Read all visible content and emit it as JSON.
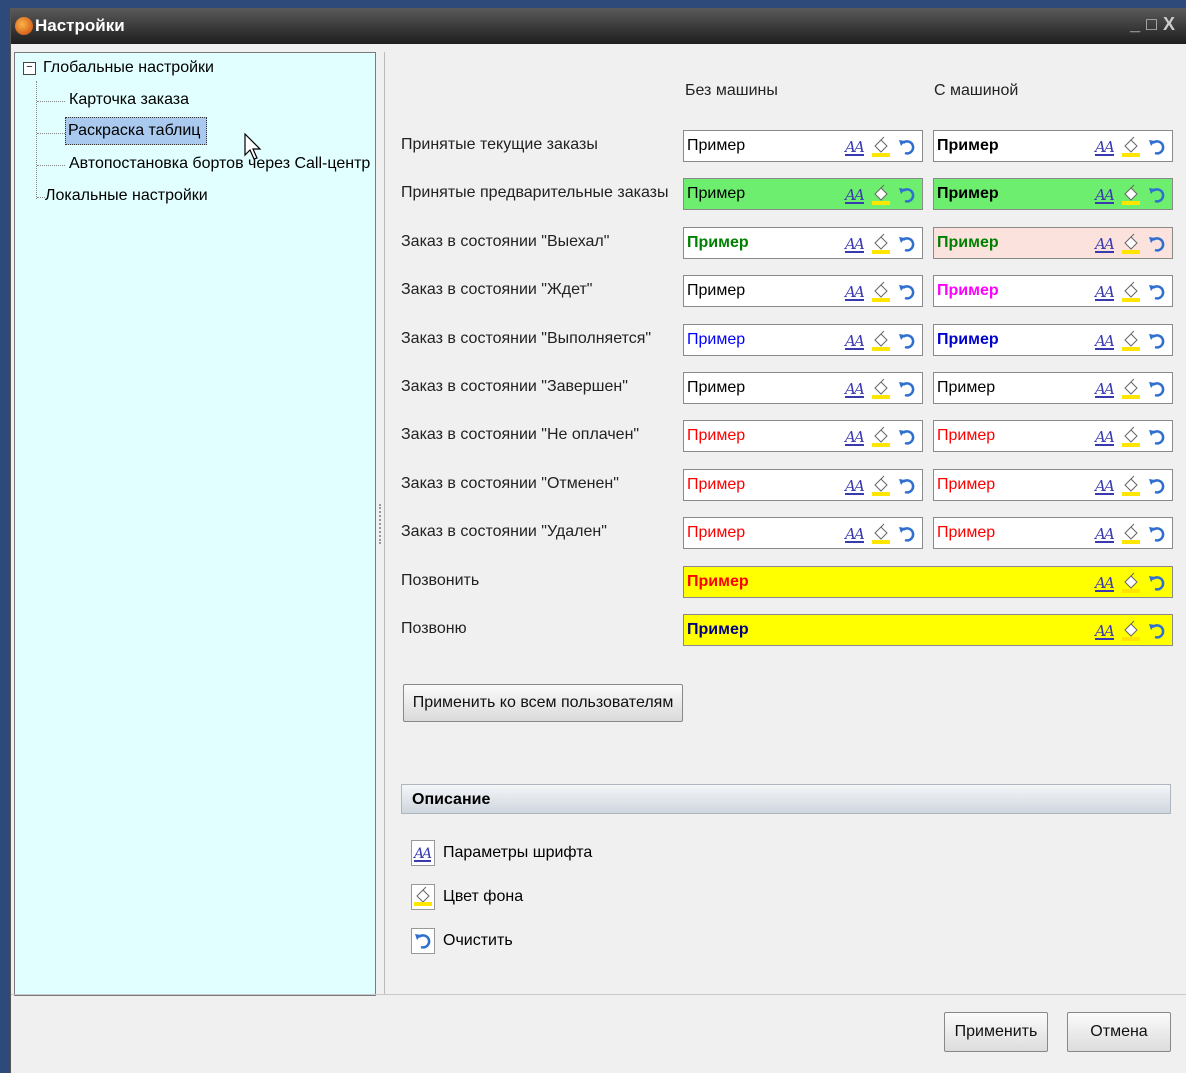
{
  "window": {
    "title": "Настройки",
    "controls": [
      "_",
      "□",
      "X"
    ]
  },
  "sidebar": {
    "nodes": [
      {
        "label": "Глобальные настройки",
        "expanded": true
      },
      {
        "label": "Карточка заказа"
      },
      {
        "label": "Раскраска таблиц",
        "selected": true
      },
      {
        "label": "Автопостановка бортов через Call-центр"
      },
      {
        "label": "Локальные настройки"
      }
    ]
  },
  "columns": {
    "without_car": "Без машины",
    "with_car": "С машиной"
  },
  "rows": [
    {
      "label": "Принятые текущие заказы",
      "a": {
        "text": "Пример",
        "color": "#000000",
        "bg": "#ffffff",
        "bold": false
      },
      "b": {
        "text": "Пример",
        "color": "#000000",
        "bg": "#ffffff",
        "bold": true
      }
    },
    {
      "label": "Принятые предварительные заказы",
      "a": {
        "text": "Пример",
        "color": "#000000",
        "bg": "#6eee6e",
        "bold": false
      },
      "b": {
        "text": "Пример",
        "color": "#000000",
        "bg": "#6eee6e",
        "bold": true
      }
    },
    {
      "label": "Заказ в состоянии \"Выехал\"",
      "a": {
        "text": "Пример",
        "color": "#008000",
        "bg": "#ffffff",
        "bold": true
      },
      "b": {
        "text": "Пример",
        "color": "#008000",
        "bg": "#fbe2dd",
        "bold": true
      }
    },
    {
      "label": "Заказ в состоянии \"Ждет\"",
      "a": {
        "text": "Пример",
        "color": "#000000",
        "bg": "#ffffff",
        "bold": false
      },
      "b": {
        "text": "Пример",
        "color": "#ff00ff",
        "bg": "#ffffff",
        "bold": true
      }
    },
    {
      "label": "Заказ в состоянии \"Выполняется\"",
      "a": {
        "text": "Пример",
        "color": "#0000ff",
        "bg": "#ffffff",
        "bold": false
      },
      "b": {
        "text": "Пример",
        "color": "#0000cc",
        "bg": "#ffffff",
        "bold": true
      }
    },
    {
      "label": "Заказ в состоянии \"Завершен\"",
      "a": {
        "text": "Пример",
        "color": "#000000",
        "bg": "#ffffff",
        "bold": false
      },
      "b": {
        "text": "Пример",
        "color": "#000000",
        "bg": "#ffffff",
        "bold": false
      }
    },
    {
      "label": "Заказ в состоянии \"Не оплачен\"",
      "a": {
        "text": "Пример",
        "color": "#ff0000",
        "bg": "#ffffff",
        "bold": false
      },
      "b": {
        "text": "Пример",
        "color": "#ff0000",
        "bg": "#ffffff",
        "bold": false
      }
    },
    {
      "label": "Заказ в состоянии \"Отменен\"",
      "a": {
        "text": "Пример",
        "color": "#ff0000",
        "bg": "#ffffff",
        "bold": false
      },
      "b": {
        "text": "Пример",
        "color": "#ff0000",
        "bg": "#ffffff",
        "bold": false
      }
    },
    {
      "label": "Заказ в состоянии \"Удален\"",
      "a": {
        "text": "Пример",
        "color": "#ff0000",
        "bg": "#ffffff",
        "bold": false
      },
      "b": {
        "text": "Пример",
        "color": "#ff0000",
        "bg": "#ffffff",
        "bold": false
      }
    },
    {
      "label": "Позвонить",
      "wide": {
        "text": "Пример",
        "color": "#ff0000",
        "bg": "#ffff00",
        "bold": true
      }
    },
    {
      "label": "Позвоню",
      "wide": {
        "text": "Пример",
        "color": "#000080",
        "bg": "#ffff00",
        "bold": true
      }
    }
  ],
  "apply_all_label": "Применить ко всем пользователям",
  "description": {
    "title": "Описание",
    "items": [
      {
        "icon": "font-icon",
        "label": "Параметры шрифта"
      },
      {
        "icon": "paint-bucket-icon",
        "label": "Цвет фона"
      },
      {
        "icon": "undo-icon",
        "label": "Очистить"
      }
    ]
  },
  "footer": {
    "apply": "Применить",
    "cancel": "Отмена"
  }
}
